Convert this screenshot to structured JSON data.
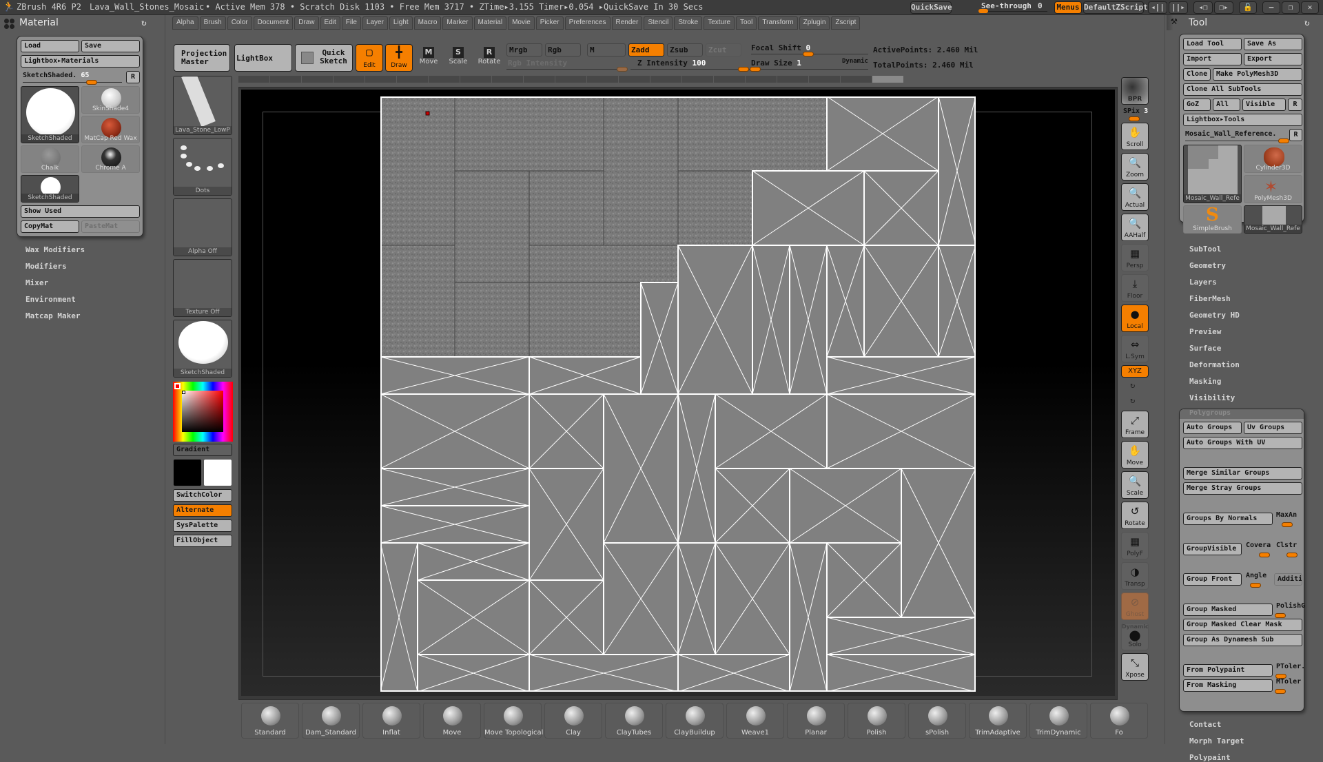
{
  "titlebar": {
    "app": "ZBrush 4R6 P2",
    "document": "Lava_Wall_Stones_Mosaic",
    "status": "• Active Mem 378 • Scratch Disk 1103 • Free Mem 3717 • ZTime▸3.155 Timer▸0.054 ▸QuickSave In 30 Secs",
    "quicksave": "QuickSave",
    "seethrough_label": "See-through",
    "seethrough_value": "0",
    "menus": "Menus",
    "script": "DefaultZScript"
  },
  "menubar": [
    "Alpha",
    "Brush",
    "Color",
    "Document",
    "Draw",
    "Edit",
    "File",
    "Layer",
    "Light",
    "Macro",
    "Marker",
    "Material",
    "Movie",
    "Picker",
    "Preferences",
    "Render",
    "Stencil",
    "Stroke",
    "Texture",
    "Tool",
    "Transform",
    "Zplugin",
    "Zscript"
  ],
  "material_panel": {
    "title": "Material",
    "load": "Load",
    "save": "Save",
    "lightbox": "Lightbox▸Materials",
    "slider_label": "SketchShaded.",
    "slider_value": "65",
    "r_button": "R",
    "thumbs": [
      "SketchShaded",
      "SkinShade4",
      "MatCap Red Wax",
      "Chalk",
      "Chrome A",
      "SketchShaded"
    ],
    "show_used": "Show Used",
    "copy_mat": "CopyMat",
    "paste_mat": "PasteMat",
    "subsections": [
      "Wax Modifiers",
      "Modifiers",
      "Mixer",
      "Environment",
      "Matcap Maker"
    ]
  },
  "left_shelf": {
    "tool_thumb": "Lava_Stone_LowP",
    "stroke_thumb": "Dots",
    "alpha_thumb": "Alpha Off",
    "texture_thumb": "Texture Off",
    "material_thumb": "SketchShaded",
    "gradient": "Gradient",
    "switch_color": "SwitchColor",
    "alternate": "Alternate",
    "syspalette": "SysPalette",
    "fill_object": "FillObject",
    "main_color": "#000000",
    "secondary_color": "#ffffff",
    "picker_color": "#ff0000"
  },
  "top_toolbar": {
    "projection_master": "Projection Master",
    "lightbox": "LightBox",
    "quick_sketch": "Quick Sketch",
    "edit": "Edit",
    "draw": "Draw",
    "move": "Move",
    "scale": "Scale",
    "rotate": "Rotate",
    "mrgb": "Mrgb",
    "rgb": "Rgb",
    "m": "M",
    "zadd": "Zadd",
    "zsub": "Zsub",
    "zcut": "Zcut",
    "rgb_intensity": "Rgb Intensity",
    "z_intensity_label": "Z Intensity",
    "z_intensity_value": "100",
    "focal_shift_label": "Focal Shift",
    "focal_shift_value": "0",
    "draw_size_label": "Draw Size",
    "draw_size_value": "1",
    "dynamic": "Dynamic",
    "active_points": "ActivePoints: 2.460 Mil",
    "total_points": "TotalPoints: 2.460 Mil"
  },
  "right_shelf": {
    "bpr": "BPR",
    "spix_label": "SPix",
    "spix_value": "3",
    "buttons": [
      "Scroll",
      "Zoom",
      "Actual",
      "AAHalf",
      "Persp",
      "Floor",
      "Local",
      "L.Sym",
      "XYZ",
      "Frame",
      "Move",
      "Scale",
      "Rotate",
      "PolyF",
      "Transp",
      "Ghost",
      "Solo",
      "Xpose"
    ],
    "solo_dynamic": "Dynamic"
  },
  "tool_panel": {
    "title": "Tool",
    "load_tool": "Load Tool",
    "save_as": "Save As",
    "import": "Import",
    "export": "Export",
    "clone": "Clone",
    "make_polymesh": "Make PolyMesh3D",
    "clone_all": "Clone All SubTools",
    "goz": "GoZ",
    "all": "All",
    "visible": "Visible",
    "r": "R",
    "lightbox_tools": "Lightbox▸Tools",
    "current_tool": "Mosaic_Wall_Reference.",
    "thumbs": [
      "Mosaic_Wall_Refe",
      "Cylinder3D",
      "PolyMesh3D",
      "SimpleBrush",
      "Mosaic_Wall_Refe"
    ],
    "subsections_top": [
      "SubTool",
      "Geometry",
      "Layers",
      "FiberMesh",
      "Geometry HD",
      "Preview",
      "Surface",
      "Deformation",
      "Masking",
      "Visibility"
    ],
    "polygroups": {
      "title": "Polygroups",
      "auto_groups": "Auto Groups",
      "uv_groups": "Uv Groups",
      "auto_groups_uv": "Auto Groups With UV",
      "merge_similar": "Merge Similar Groups",
      "merge_stray": "Merge Stray Groups",
      "groups_by_normals": "Groups By Normals",
      "maxangle": "MaxAn",
      "group_visible": "GroupVisible",
      "coverage": "Covera",
      "clstr": "Clstr",
      "group_front": "Group Front",
      "angle": "Angle",
      "additive": "Additiv",
      "group_masked": "Group Masked",
      "polishg": "PolishG",
      "group_masked_clear": "Group Masked Clear Mask",
      "group_dynamesh": "Group As Dynamesh Sub",
      "from_polypaint": "From Polypaint",
      "ptoler": "PToler.",
      "from_masking": "From Masking",
      "mtoler": "MToler"
    },
    "subsections_bottom": [
      "Contact",
      "Morph Target",
      "Polypaint"
    ]
  },
  "brushes": [
    "Standard",
    "Dam_Standard",
    "Inflat",
    "Move",
    "Move Topological",
    "Clay",
    "ClayTubes",
    "ClayBuildup",
    "Weave1",
    "Planar",
    "Polish",
    "sPolish",
    "TrimAdaptive",
    "TrimDynamic",
    "Fo"
  ],
  "uv_layout": {
    "grid_units": 16,
    "textured": [
      [
        0,
        0,
        2,
        4
      ],
      [
        2,
        0,
        4,
        2
      ],
      [
        6,
        0,
        2,
        4
      ],
      [
        8,
        0,
        4,
        2
      ],
      [
        2,
        2,
        2,
        3
      ],
      [
        4,
        2,
        2,
        2
      ],
      [
        8,
        2,
        2,
        2
      ],
      [
        0,
        4,
        2,
        3
      ],
      [
        4,
        4,
        4,
        1
      ],
      [
        2,
        5,
        2,
        2
      ],
      [
        4,
        5,
        3,
        2
      ]
    ],
    "untextured": [
      [
        12,
        0,
        3,
        2
      ],
      [
        15,
        0,
        1,
        4
      ],
      [
        10,
        2,
        3,
        2
      ],
      [
        13,
        2,
        2,
        2
      ],
      [
        7,
        5,
        1,
        3
      ],
      [
        8,
        4,
        2,
        4
      ],
      [
        10,
        4,
        1,
        4
      ],
      [
        11,
        4,
        1,
        4
      ],
      [
        12,
        4,
        1,
        3
      ],
      [
        13,
        4,
        2,
        3
      ],
      [
        15,
        4,
        1,
        3
      ],
      [
        12,
        7,
        4,
        1
      ],
      [
        0,
        7,
        4,
        1
      ],
      [
        4,
        7,
        3,
        1
      ],
      [
        0,
        8,
        4,
        2
      ],
      [
        4,
        8,
        2,
        2
      ],
      [
        6,
        8,
        2,
        4
      ],
      [
        8,
        8,
        1,
        4
      ],
      [
        9,
        8,
        3,
        2
      ],
      [
        12,
        8,
        4,
        2
      ],
      [
        0,
        10,
        4,
        1
      ],
      [
        0,
        11,
        4,
        1
      ],
      [
        4,
        10,
        2,
        3
      ],
      [
        9,
        10,
        2,
        2
      ],
      [
        11,
        10,
        3,
        2
      ],
      [
        14,
        10,
        2,
        4
      ],
      [
        0,
        12,
        1,
        4
      ],
      [
        1,
        12,
        3,
        1
      ],
      [
        1,
        13,
        3,
        2
      ],
      [
        4,
        13,
        2,
        2
      ],
      [
        6,
        12,
        2,
        3
      ],
      [
        8,
        12,
        1,
        3
      ],
      [
        9,
        12,
        2,
        3
      ],
      [
        11,
        12,
        1,
        4
      ],
      [
        12,
        12,
        2,
        2
      ],
      [
        12,
        14,
        4,
        1
      ],
      [
        12,
        15,
        4,
        1
      ],
      [
        1,
        15,
        3,
        1
      ],
      [
        4,
        15,
        4,
        1
      ],
      [
        8,
        15,
        3,
        1
      ]
    ]
  }
}
